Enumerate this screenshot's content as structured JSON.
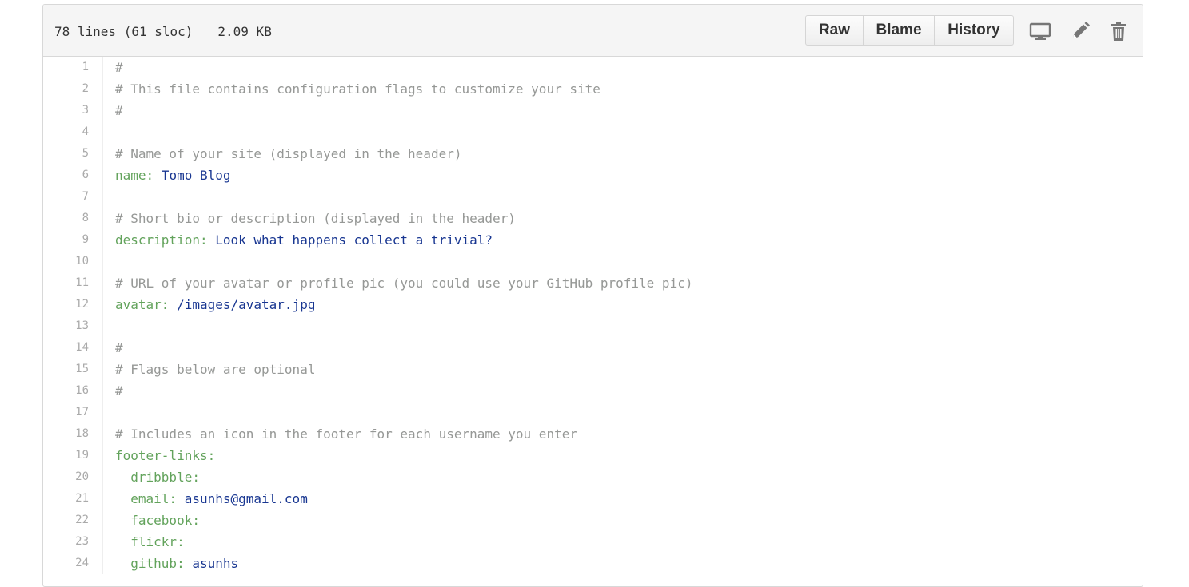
{
  "file_info": {
    "lines": "78 lines (61 sloc)",
    "size": "2.09 KB"
  },
  "actions": {
    "raw_label": "Raw",
    "blame_label": "Blame",
    "history_label": "History",
    "desktop_icon": "desktop-icon",
    "edit_icon": "pencil-icon",
    "delete_icon": "trash-icon"
  },
  "colors": {
    "comment": "#969896",
    "key": "#63a35c",
    "value": "#183691",
    "line_number": "#aaaaaa"
  },
  "code_lines": [
    {
      "num": "1",
      "comment": "#",
      "key": "",
      "value": ""
    },
    {
      "num": "2",
      "comment": "# This file contains configuration flags to customize your site",
      "key": "",
      "value": ""
    },
    {
      "num": "3",
      "comment": "#",
      "key": "",
      "value": ""
    },
    {
      "num": "4",
      "comment": "",
      "key": "",
      "value": ""
    },
    {
      "num": "5",
      "comment": "# Name of your site (displayed in the header)",
      "key": "",
      "value": ""
    },
    {
      "num": "6",
      "comment": "",
      "key": "name:",
      "value": " Tomo Blog"
    },
    {
      "num": "7",
      "comment": "",
      "key": "",
      "value": ""
    },
    {
      "num": "8",
      "comment": "# Short bio or description (displayed in the header)",
      "key": "",
      "value": ""
    },
    {
      "num": "9",
      "comment": "",
      "key": "description:",
      "value": " Look what happens collect a trivial?"
    },
    {
      "num": "10",
      "comment": "",
      "key": "",
      "value": ""
    },
    {
      "num": "11",
      "comment": "# URL of your avatar or profile pic (you could use your GitHub profile pic)",
      "key": "",
      "value": ""
    },
    {
      "num": "12",
      "comment": "",
      "key": "avatar:",
      "value": " /images/avatar.jpg"
    },
    {
      "num": "13",
      "comment": "",
      "key": "",
      "value": ""
    },
    {
      "num": "14",
      "comment": "#",
      "key": "",
      "value": ""
    },
    {
      "num": "15",
      "comment": "# Flags below are optional",
      "key": "",
      "value": ""
    },
    {
      "num": "16",
      "comment": "#",
      "key": "",
      "value": ""
    },
    {
      "num": "17",
      "comment": "",
      "key": "",
      "value": ""
    },
    {
      "num": "18",
      "comment": "# Includes an icon in the footer for each username you enter",
      "key": "",
      "value": ""
    },
    {
      "num": "19",
      "comment": "",
      "key": "footer-links:",
      "value": ""
    },
    {
      "num": "20",
      "comment": "",
      "key": "  dribbble:",
      "value": ""
    },
    {
      "num": "21",
      "comment": "",
      "key": "  email:",
      "value": " asunhs@gmail.com"
    },
    {
      "num": "22",
      "comment": "",
      "key": "  facebook:",
      "value": ""
    },
    {
      "num": "23",
      "comment": "",
      "key": "  flickr:",
      "value": ""
    },
    {
      "num": "24",
      "comment": "",
      "key": "  github:",
      "value": " asunhs"
    }
  ]
}
